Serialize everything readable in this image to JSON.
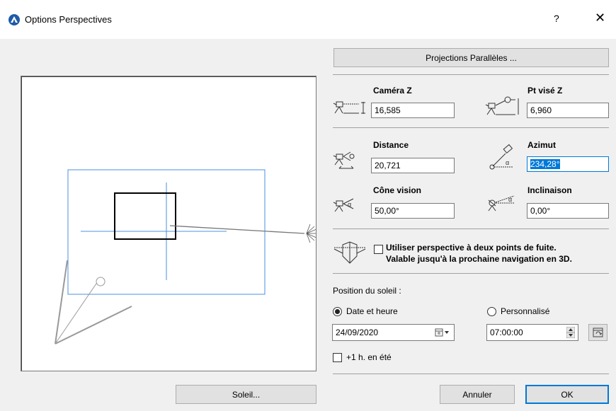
{
  "window": {
    "title": "Options Perspectives",
    "help_label": "?",
    "close_label": "✕"
  },
  "buttons": {
    "parallel": "Projections Parallèles ...",
    "sun": "Soleil...",
    "cancel": "Annuler",
    "ok": "OK"
  },
  "camera_z": {
    "label": "Caméra Z",
    "value": "16,585"
  },
  "target_z": {
    "label": "Pt visé Z",
    "value": "6,960"
  },
  "distance": {
    "label": "Distance",
    "value": "20,721"
  },
  "azimuth": {
    "label": "Azimut",
    "value": "234,28°"
  },
  "cone": {
    "label": "Cône vision",
    "value": "50,00°"
  },
  "tilt": {
    "label": "Inclinaison",
    "value": "0,00°"
  },
  "two_point": {
    "line1": "Utiliser perspective à deux points de fuite.",
    "line2": "Valable jusqu'à la prochaine navigation en 3D."
  },
  "sun": {
    "heading": "Position du soleil :",
    "date_time_label": "Date et heure",
    "custom_label": "Personnalisé",
    "date": "24/09/2020",
    "time": "07:00:00",
    "dst_label": "+1 h. en été",
    "mode": "date_time"
  },
  "colors": {
    "accent": "#0078d7",
    "guide": "#4a90e2"
  }
}
